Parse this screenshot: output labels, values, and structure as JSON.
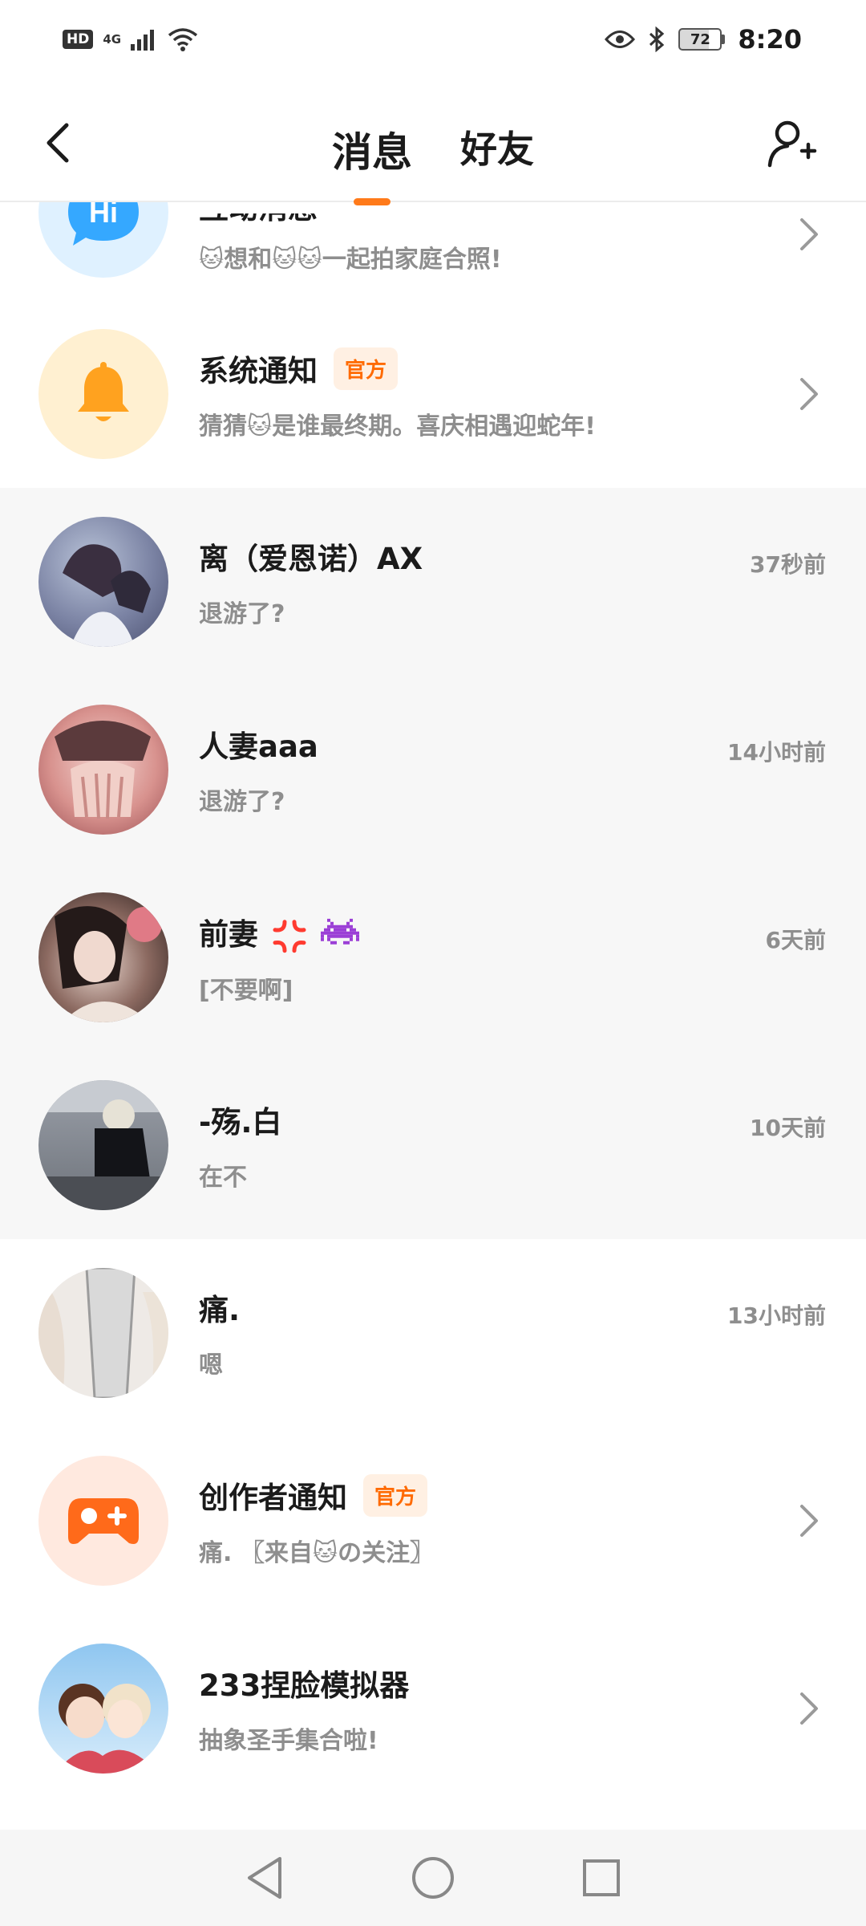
{
  "status_bar": {
    "hd": "HD",
    "network": "4G",
    "battery": "72",
    "time": "8:20"
  },
  "header": {
    "tabs": [
      {
        "label": "消息",
        "active": true
      },
      {
        "label": "好友",
        "active": false
      }
    ]
  },
  "accent_color": "#ff7a1a",
  "messages": [
    {
      "name": "互动消息",
      "preview": "🐱想和🐱🐱一起拍家庭合照!",
      "kind": "system",
      "icon": "hi-bubble-icon"
    },
    {
      "name": "系统通知",
      "badge": "官方",
      "preview": "猜猜🐱是谁最终期。喜庆相遇迎蛇年!",
      "kind": "system",
      "icon": "bell-icon"
    },
    {
      "name": "离（爱恩诺）AX",
      "preview": "退游了?",
      "time": "37秒前",
      "avatar": "anime-avatar"
    },
    {
      "name": "人妻aaa",
      "preview": "退游了?",
      "time": "14小时前",
      "avatar": "anime-avatar"
    },
    {
      "name": "前妻",
      "preview": "[不要啊]",
      "time": "6天前",
      "avatar": "photo-avatar",
      "emojis": [
        "anger-emoji",
        "alien-monster-emoji"
      ]
    },
    {
      "name": "-殇.白",
      "preview": "在不",
      "time": "10天前",
      "avatar": "photo-avatar"
    },
    {
      "name": "痛.",
      "preview": "嗯",
      "time": "13小时前",
      "avatar": "photo-avatar"
    },
    {
      "name": "创作者通知",
      "badge": "官方",
      "preview": "痛.  〖来自🐱の关注〗",
      "kind": "system",
      "icon": "gamepad-icon"
    },
    {
      "name": "233捏脸模拟器",
      "preview": "抽象圣手集合啦!",
      "kind": "system",
      "icon": "anime-avatar"
    }
  ]
}
